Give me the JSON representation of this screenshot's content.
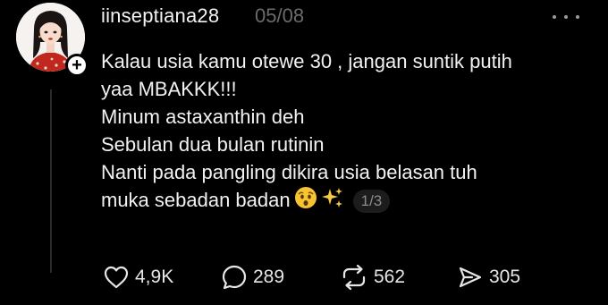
{
  "post": {
    "username": "iinseptiana28",
    "date": "05/08",
    "lines": [
      "Kalau usia kamu otewe 30 , jangan suntik putih",
      "yaa MBAKKK!!!",
      "Minum astaxanthin deh",
      "Sebulan dua bulan rutinin",
      "Nanti pada pangling dikira usia belasan tuh",
      "muka sebadan badan"
    ],
    "emojis": [
      "astonished-face-emoji",
      "sparkles-emoji"
    ],
    "media_page": "1/3"
  },
  "actions": {
    "likes": "4,9K",
    "replies": "289",
    "reposts": "562",
    "shares": "305"
  },
  "colors": {
    "background": "#000000",
    "text": "#f2f2f2",
    "muted": "#6b6b6b"
  }
}
